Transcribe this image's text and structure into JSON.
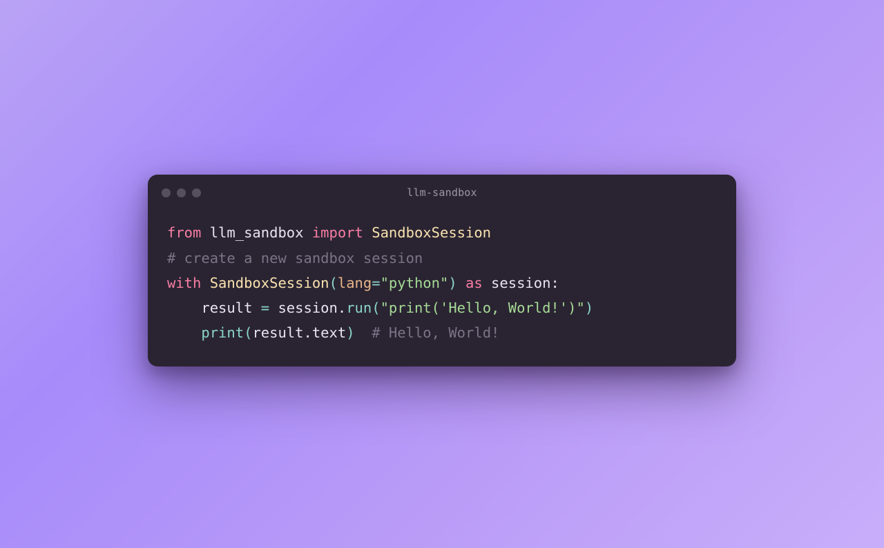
{
  "window": {
    "title": "llm-sandbox"
  },
  "code": {
    "line1": {
      "kw_from": "from",
      "module": "llm_sandbox",
      "kw_import": "import",
      "cls": "SandboxSession"
    },
    "line2": {
      "blank": ""
    },
    "line3": {
      "comment": "# create a new sandbox session"
    },
    "line4": {
      "kw_with": "with",
      "cls": "SandboxSession",
      "lparen": "(",
      "param": "lang",
      "eq": "=",
      "str": "\"python\"",
      "rparen": ")",
      "kw_as": "as",
      "var": "session",
      "colon": ":"
    },
    "line5": {
      "indent": "    ",
      "var": "result",
      "eq": " = ",
      "obj": "session",
      "dot": ".",
      "method": "run",
      "lparen": "(",
      "str": "\"print('Hello, World!')\"",
      "rparen": ")"
    },
    "line6": {
      "indent": "    ",
      "fn": "print",
      "lparen": "(",
      "obj": "result",
      "dot": ".",
      "prop": "text",
      "rparen": ")",
      "space": "  ",
      "comment": "# Hello, World!"
    }
  }
}
